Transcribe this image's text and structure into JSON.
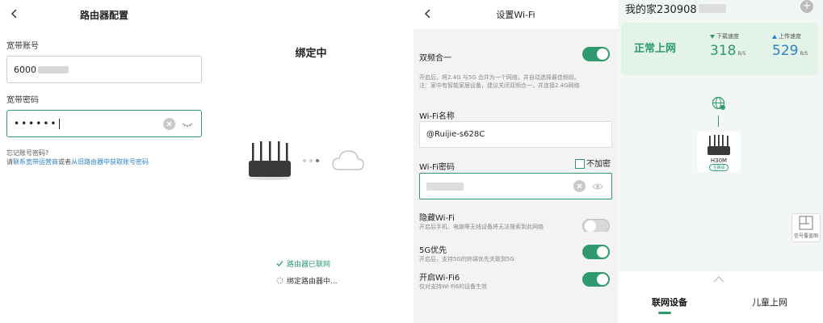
{
  "router_config": {
    "title": "路由器配置",
    "account_label": "宽带账号",
    "account_value": "6000",
    "password_label": "宽带密码",
    "password_mask": "••••••",
    "forgot_question": "忘记账号密码?",
    "forgot_prefix": "请",
    "contact_link": "联系宽带运营商",
    "forgot_or": "或者",
    "old_router_link": "从旧路由器中获取账号密码"
  },
  "binding": {
    "title": "绑定中",
    "step1": "路由器已联网",
    "step2": "绑定路由器中..."
  },
  "wifi_settings": {
    "title": "设置Wi-Fi",
    "dual_band_label": "双频合一",
    "dual_band_desc1": "开启后，将2.4G 与5G 合并为一个网络，并自动选择最佳频段。",
    "dual_band_desc2": "注：家中有智能家居设备，建议关闭双频合一，并连接2.4G网络",
    "wifi_name_label": "Wi-Fi名称",
    "wifi_name_value": "@Ruijie-s628C",
    "wifi_password_label": "Wi-Fi密码",
    "no_encrypt_label": "不加密",
    "hide_wifi_label": "隐藏Wi-Fi",
    "hide_wifi_desc": "开启后手机、电脑等无线设备将无法搜索到此网络",
    "g5_priority_label": "5G优先",
    "g5_priority_desc": "开启后，支持5G的终端优先关联到5G",
    "wifi6_label": "开启Wi-Fi6",
    "wifi6_desc": "仅对支持Wi-Fi6的设备生效"
  },
  "home": {
    "title": "我的家230908",
    "status": "正常上网",
    "download_label": "下载速度",
    "download_value": "318",
    "download_unit": "B/S",
    "upload_label": "上传速度",
    "upload_value": "529",
    "upload_unit": "B/S",
    "router_model": "H30M",
    "router_badge": "主路由",
    "coverage_label": "信号覆盖图",
    "tab_devices": "联网设备",
    "tab_kids": "儿童上网"
  },
  "colors": {
    "accent": "#2e9a6e",
    "link": "#2a82c8",
    "upload": "#2a82c8"
  }
}
